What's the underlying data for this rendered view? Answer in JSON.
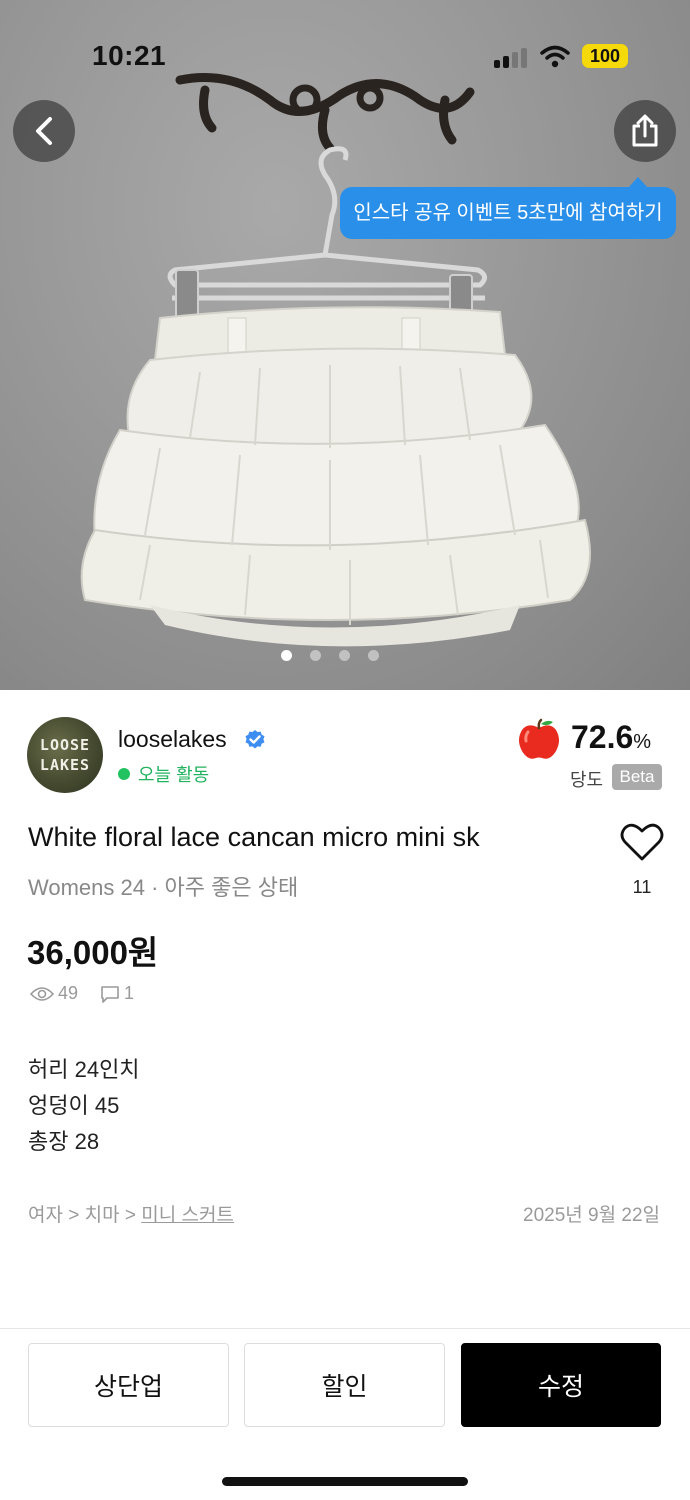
{
  "status_bar": {
    "time": "10:21",
    "battery": "100",
    "battery_color": "#f5d90a"
  },
  "photo": {
    "description_icon": "skirt-photo",
    "page_count": 4,
    "active_page": 1
  },
  "tooltip": {
    "text": "인스타 공유 이벤트 5초만에 참여하기",
    "color": "#2a8fe8"
  },
  "seller": {
    "avatar_text_line1": "LOOSE",
    "avatar_text_line2": "LAKES",
    "name": "looselakes",
    "activity": "오늘 활동"
  },
  "sweetness": {
    "value": "72.6",
    "unit": "%",
    "label": "당도",
    "badge": "Beta"
  },
  "product": {
    "title": "White floral lace cancan micro mini sk",
    "subtitle": "Womens 24 · 아주 좋은 상태",
    "price": "36,000원",
    "views": "49",
    "comments": "1",
    "likes": "11",
    "description": [
      "허리 24인치",
      "엉덩이 45",
      "총장 28"
    ],
    "category_prefix": "여자 > 치마 > ",
    "category_link": "미니 스커트",
    "date": "2025년 9월 22일"
  },
  "actions": {
    "bump": "상단업",
    "discount": "할인",
    "edit": "수정"
  }
}
